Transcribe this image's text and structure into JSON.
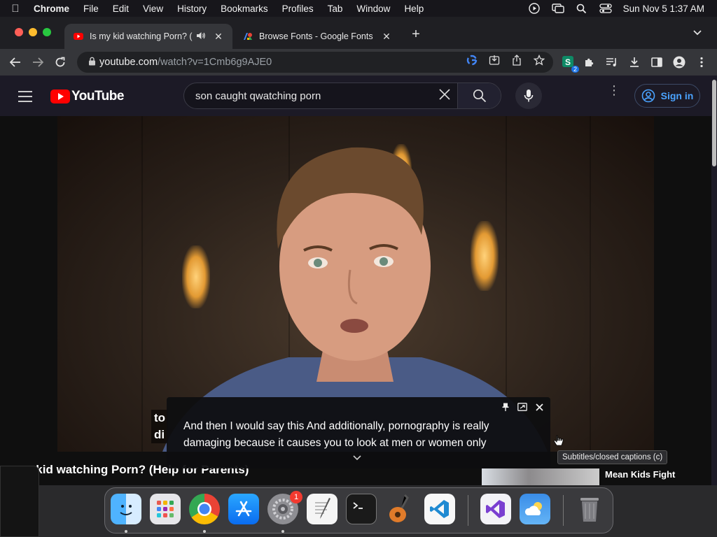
{
  "menubar": {
    "app": "Chrome",
    "items": [
      "File",
      "Edit",
      "View",
      "History",
      "Bookmarks",
      "Profiles",
      "Tab",
      "Window",
      "Help"
    ],
    "clock": "Sun Nov 5  1:37 AM"
  },
  "tabs": [
    {
      "title": "Is my kid watching Porn? (",
      "active": true,
      "audio": true
    },
    {
      "title": "Browse Fonts - Google Fonts",
      "active": false
    }
  ],
  "omnibox": {
    "host": "youtube.com",
    "path": "/watch?v=1Cmb6g9AJE0"
  },
  "extension_badge": "2",
  "youtube": {
    "logo": "YouTube",
    "search_query": "son caught qwatching porn",
    "signin": "Sign in",
    "video_overlay_caption_1": "to",
    "video_overlay_caption_2": "di",
    "video_title": "my kid watching Porn? (Help for Parents)",
    "rec_title": "Mean Kids Fight"
  },
  "caption_popup": {
    "text": "And then I would say this And additionally, pornography is really damaging because it causes you to look at men or women only"
  },
  "tooltip": "Subtitles/closed captions (c)",
  "dock": {
    "apps": [
      "Finder",
      "Launchpad",
      "Google Chrome",
      "App Store",
      "System Settings",
      "TextEdit",
      "Terminal",
      "GarageBand",
      "Visual Studio Code",
      "Visual Studio",
      "Weather",
      "Trash"
    ],
    "settings_badge": "1"
  },
  "colors": {
    "youtube_red": "#ff0000",
    "signin_blue": "#4aa3ff",
    "tab_active": "#35363a"
  }
}
